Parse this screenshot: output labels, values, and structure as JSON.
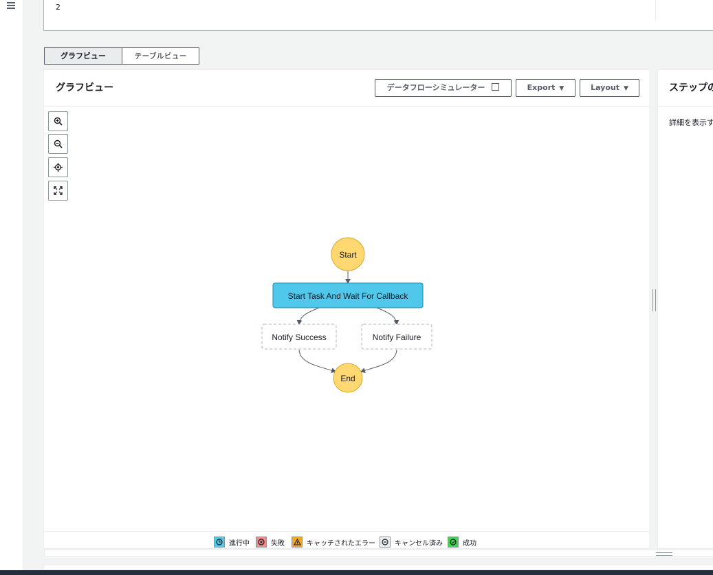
{
  "top_panel": {
    "value": "2"
  },
  "view_tabs": [
    {
      "label": "グラフビュー",
      "active": true
    },
    {
      "label": "テーブルビュー",
      "active": false
    }
  ],
  "graph_panel": {
    "title": "グラフビュー",
    "buttons": {
      "simulator": "データフローシミュレーター",
      "export": "Export",
      "layout": "Layout"
    }
  },
  "diagram": {
    "nodes": {
      "start": "Start",
      "task": "Start Task And Wait For Callback",
      "notify_success": "Notify Success",
      "notify_failure": "Notify Failure",
      "end": "End"
    },
    "colors": {
      "terminal": "#ffd872",
      "terminal_border": "#d9a82a",
      "task": "#50c8eb",
      "task_border": "#1d8eb3",
      "edge": "#545b64"
    }
  },
  "legend": [
    {
      "label": "進行中",
      "color": "#50c8eb",
      "icon": "clock-icon"
    },
    {
      "label": "失敗",
      "color": "#f08b8b",
      "icon": "x-circle-icon"
    },
    {
      "label": "キャッチされたエラー",
      "color": "#f5a623",
      "icon": "warning-icon"
    },
    {
      "label": "キャンセル済み",
      "color": "#eaeded",
      "icon": "minus-circle-icon"
    },
    {
      "label": "成功",
      "color": "#3fd44b",
      "icon": "check-circle-icon"
    }
  ],
  "details_panel": {
    "title": "ステップの",
    "hint": "詳細を表示す"
  }
}
